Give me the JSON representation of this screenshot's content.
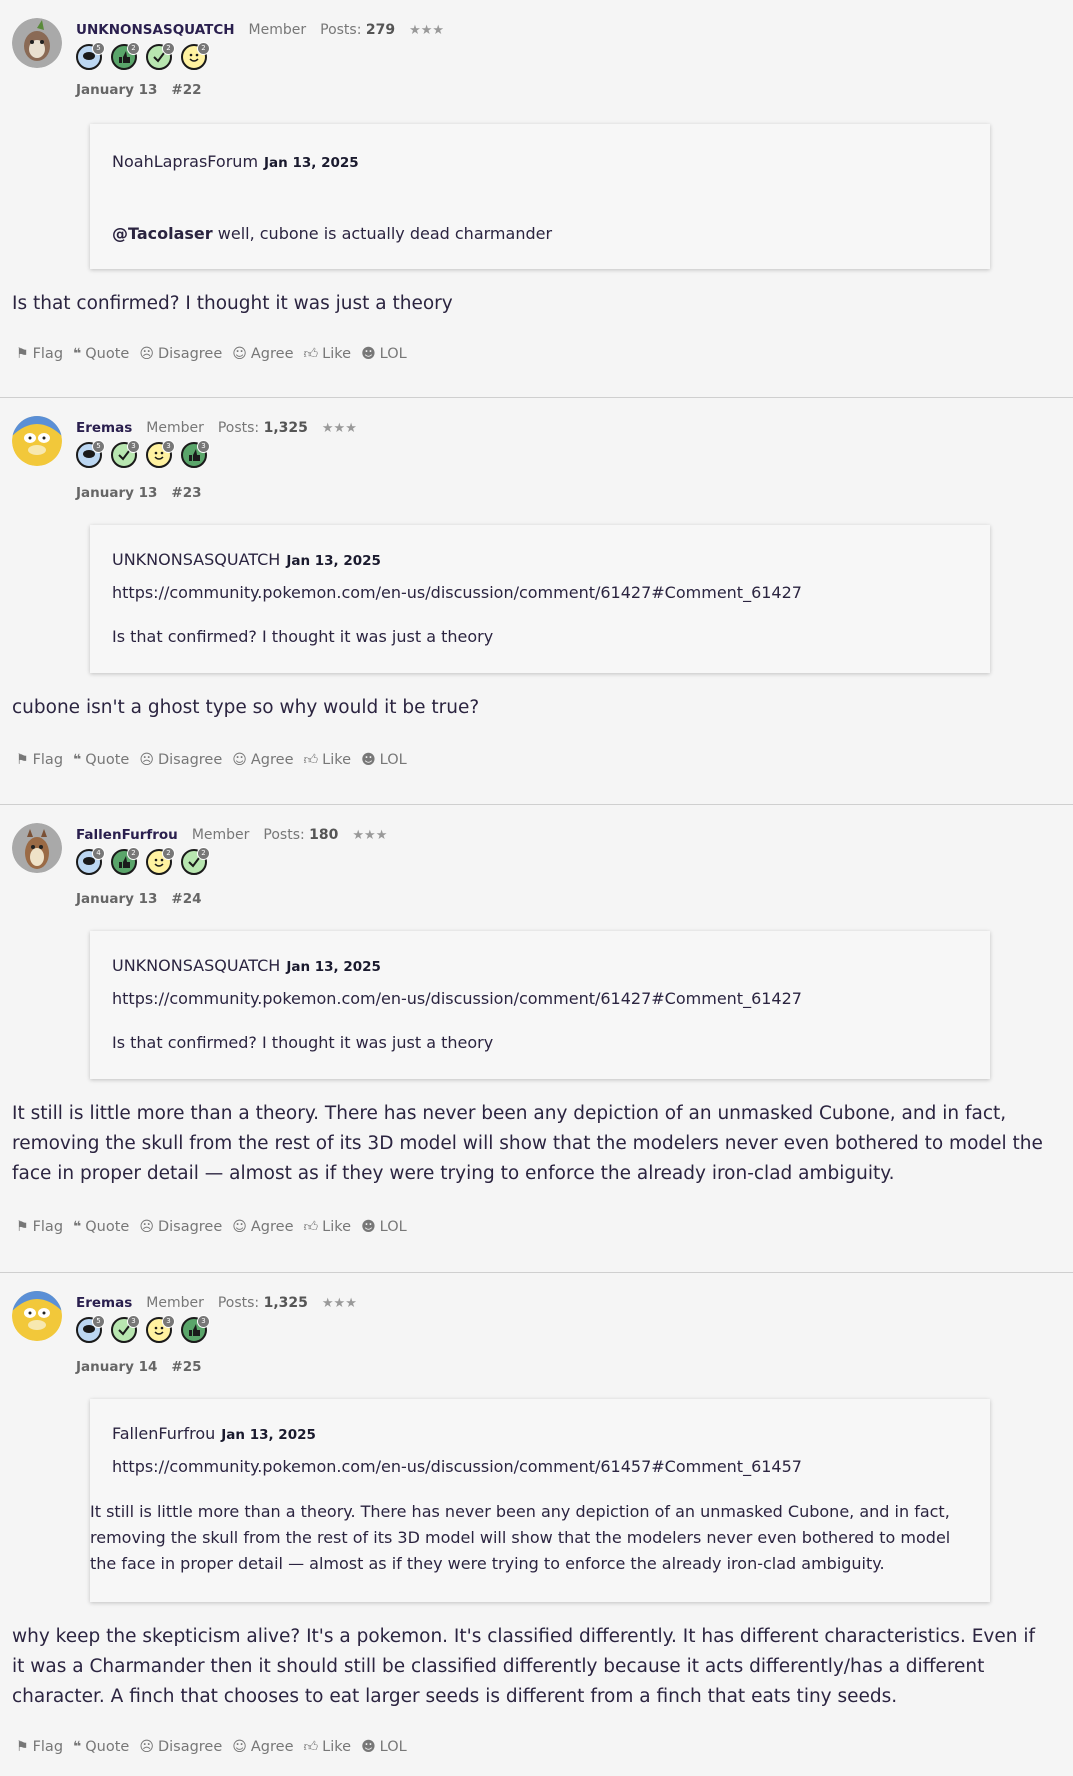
{
  "actions": {
    "flag": "Flag",
    "quote": "Quote",
    "disagree": "Disagree",
    "agree": "Agree",
    "like": "Like",
    "lol": "LOL"
  },
  "posts": [
    {
      "username": "UNKNONSASQUATCH",
      "role": "Member",
      "posts_label": "Posts:",
      "posts_count": "279",
      "stars": "★★★",
      "date": "January 13",
      "number": "#22",
      "quote_author": "NoahLaprasForum",
      "quote_date": "Jan 13, 2025",
      "quote_link": "",
      "quote_mention": "@Tacolaser",
      "quote_text": " well, cubone is actually dead charmander",
      "body": "Is that confirmed? I thought it was just a theory"
    },
    {
      "username": "Eremas",
      "role": "Member",
      "posts_label": "Posts:",
      "posts_count": "1,325",
      "stars": "★★★",
      "date": "January 13",
      "number": "#23",
      "quote_author": "UNKNONSASQUATCH",
      "quote_date": "Jan 13, 2025",
      "quote_link": "https://community.pokemon.com/en-us/discussion/comment/61427#Comment_61427",
      "quote_text": "Is that confirmed? I thought it was just a theory",
      "body": "cubone isn't a ghost type so why would it be true?"
    },
    {
      "username": "FallenFurfrou",
      "role": "Member",
      "posts_label": "Posts:",
      "posts_count": "180",
      "stars": "★★★",
      "date": "January 13",
      "number": "#24",
      "quote_author": "UNKNONSASQUATCH",
      "quote_date": "Jan 13, 2025",
      "quote_link": "https://community.pokemon.com/en-us/discussion/comment/61427#Comment_61427",
      "quote_text": "Is that confirmed? I thought it was just a theory",
      "body": "It still is little more than a theory. There has never been any depiction of an unmasked Cubone, and in fact, removing the skull from the rest of its 3D model will show that the modelers never even bothered to model the face in proper detail — almost as if they were trying to enforce the already iron-clad ambiguity."
    },
    {
      "username": "Eremas",
      "role": "Member",
      "posts_label": "Posts:",
      "posts_count": "1,325",
      "stars": "★★★",
      "date": "January 14",
      "number": "#25",
      "quote_author": "FallenFurfrou",
      "quote_date": "Jan 13, 2025",
      "quote_link": "https://community.pokemon.com/en-us/discussion/comment/61457#Comment_61457",
      "quote_text": "It still is little more than a theory. There has never been any depiction of an unmasked Cubone, and in fact, removing the skull from the rest of its 3D model will show that the modelers never even bothered to model the face in proper detail — almost as if they were trying to enforce the already iron-clad ambiguity.",
      "body": "why keep the skepticism alive? It's a pokemon. It's classified differently. It has different characteristics. Even if it was a Charmander then it should still be classified differently because it acts differently/has a different character. A finch that chooses to eat larger seeds is different from a finch that eats tiny seeds."
    }
  ]
}
